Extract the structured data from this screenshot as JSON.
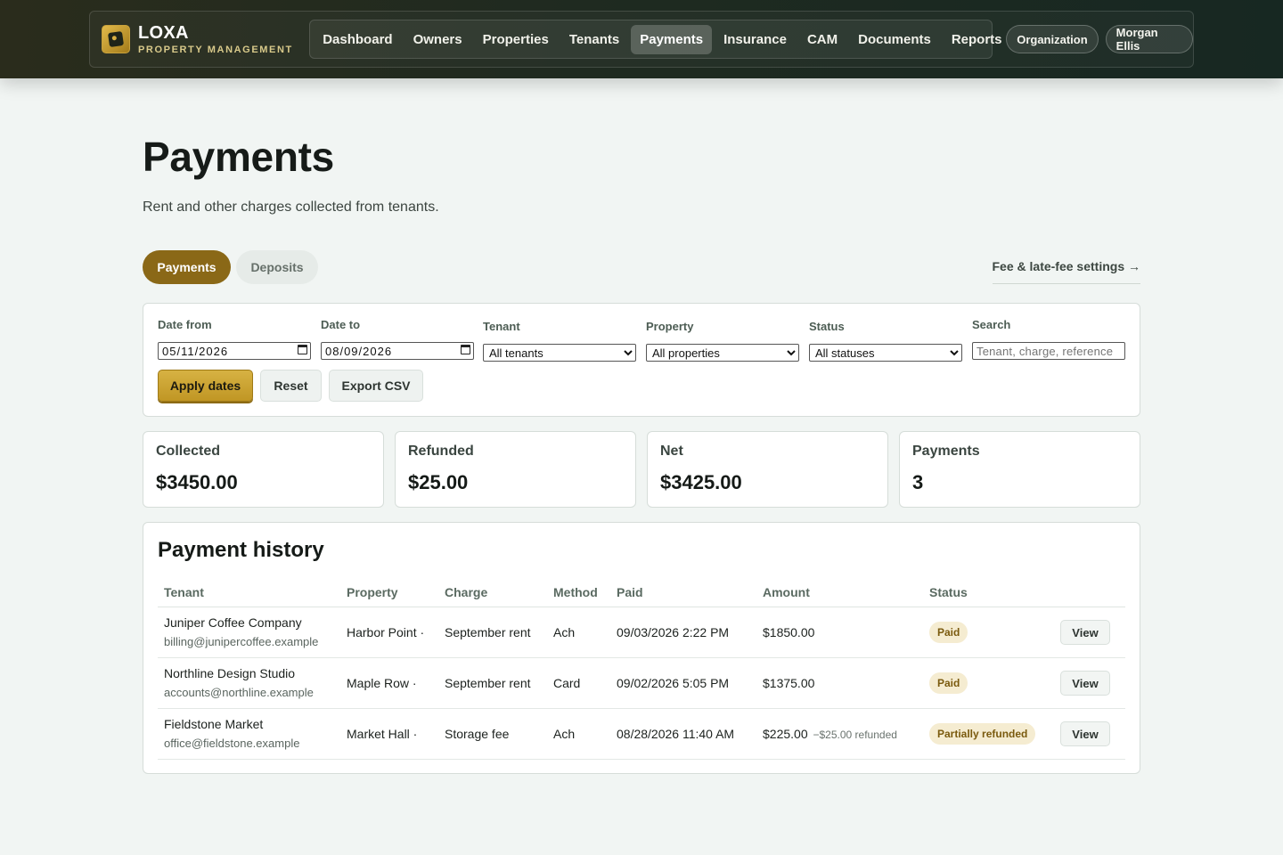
{
  "brand": {
    "name": "LOXA",
    "subtitle": "PROPERTY MANAGEMENT"
  },
  "nav": {
    "items": [
      "Dashboard",
      "Owners",
      "Properties",
      "Tenants",
      "Payments",
      "Insurance",
      "CAM",
      "Documents",
      "Reports"
    ],
    "active": "Payments"
  },
  "header_buttons": {
    "organization": "Organization",
    "user": "Morgan Ellis"
  },
  "page": {
    "title": "Payments",
    "subtitle": "Rent and other charges collected from tenants."
  },
  "tabs": {
    "payments": "Payments",
    "deposits": "Deposits",
    "active": "Payments"
  },
  "fee_link": "Fee & late-fee settings →",
  "filters": {
    "date_from": {
      "label": "Date from",
      "value": "05/11/2026"
    },
    "date_to": {
      "label": "Date to",
      "value": "08/09/2026"
    },
    "tenant": {
      "label": "Tenant",
      "value": "All tenants"
    },
    "property": {
      "label": "Property",
      "value": "All properties"
    },
    "status": {
      "label": "Status",
      "value": "All statuses"
    },
    "search": {
      "label": "Search",
      "placeholder": "Tenant, charge, reference"
    },
    "apply_label": "Apply dates",
    "reset_label": "Reset",
    "export_label": "Export CSV"
  },
  "stats": {
    "collected": {
      "label": "Collected",
      "value": "$3450.00"
    },
    "refunded": {
      "label": "Refunded",
      "value": "$25.00"
    },
    "net": {
      "label": "Net",
      "value": "$3425.00"
    },
    "payments": {
      "label": "Payments",
      "value": "3"
    }
  },
  "history": {
    "title": "Payment history",
    "columns": [
      "Tenant",
      "Property",
      "Charge",
      "Method",
      "Paid",
      "Amount",
      "Status",
      ""
    ],
    "rows": [
      {
        "tenant": "Juniper Coffee Company",
        "email": "billing@junipercoffee.example",
        "property": "Harbor Point ·",
        "charge": "September rent",
        "method": "Ach",
        "paid": "09/03/2026 2:22 PM",
        "amount": "$1850.00",
        "refund_note": "",
        "status": "Paid",
        "action": "View"
      },
      {
        "tenant": "Northline Design Studio",
        "email": "accounts@northline.example",
        "property": "Maple Row ·",
        "charge": "September rent",
        "method": "Card",
        "paid": "09/02/2026 5:05 PM",
        "amount": "$1375.00",
        "refund_note": "",
        "status": "Paid",
        "action": "View"
      },
      {
        "tenant": "Fieldstone Market",
        "email": "office@fieldstone.example",
        "property": "Market Hall ·",
        "charge": "Storage fee",
        "method": "Ach",
        "paid": "08/28/2026 11:40 AM",
        "amount": "$225.00",
        "refund_note": "−$25.00 refunded",
        "status": "Partially refunded",
        "action": "View"
      }
    ]
  },
  "colors": {
    "accent": "#8a6817",
    "button_gold": "#c9a22e",
    "badge_bg": "#f5ecd1",
    "topbar": "#1f2a20",
    "page_bg": "#f1f5f3"
  }
}
